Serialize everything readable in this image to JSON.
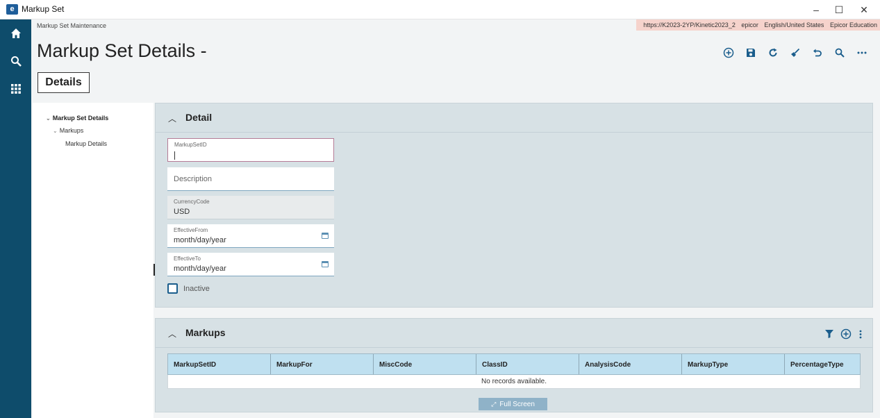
{
  "window": {
    "app_icon": "e",
    "title": "Markup Set",
    "minimize": "–",
    "maximize": "☐",
    "close": "✕"
  },
  "leftnav": {
    "icons": [
      "home-icon",
      "search-icon",
      "apps-grid-icon"
    ]
  },
  "breadcrumb": "Markup Set Maintenance",
  "header_info": {
    "url": "https://K2023-2YP/Kinetic2023_2",
    "company": "epicor",
    "language": "English/United States",
    "site": "Epicor Education"
  },
  "page_title": "Markup Set Details -",
  "toolbar": [
    "add-new-icon",
    "save-icon",
    "refresh-icon",
    "clear-icon",
    "undo-icon",
    "search-icon",
    "more-icon"
  ],
  "tabs": {
    "details": "Details"
  },
  "tree": {
    "root": "Markup Set Details",
    "child": "Markups",
    "grandchild": "Markup Details"
  },
  "detail_panel": {
    "title": "Detail",
    "fields": {
      "markup_set_id": {
        "label": "MarkupSetID",
        "value": ""
      },
      "description": {
        "placeholder": "Description"
      },
      "currency_code": {
        "label": "CurrencyCode",
        "value": "USD"
      },
      "effective_from": {
        "label": "EffectiveFrom",
        "value": "month/day/year"
      },
      "effective_to": {
        "label": "EffectiveTo",
        "value": "month/day/year"
      }
    },
    "inactive_label": "Inactive"
  },
  "markups_panel": {
    "title": "Markups",
    "columns": [
      "MarkupSetID",
      "MarkupFor",
      "MiscCode",
      "ClassID",
      "AnalysisCode",
      "MarkupType",
      "PercentageType"
    ],
    "empty_text": "No records available.",
    "fullscreen_label": "Full Screen"
  },
  "colors": {
    "nav_bg": "#0e4c6b",
    "accent": "#1a5d8c",
    "panel_bg": "#d7e1e5",
    "grid_header_bg": "#bfe0f0",
    "header_info_bg": "#f6d3cc"
  }
}
